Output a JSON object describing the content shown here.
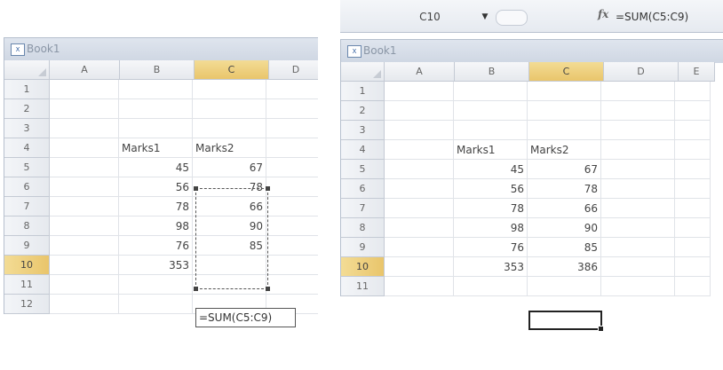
{
  "left": {
    "window_title": "Book1",
    "columns": [
      "A",
      "B",
      "C",
      "D"
    ],
    "selected_column": "C",
    "rows": [
      {
        "num": "1",
        "b": "",
        "c": ""
      },
      {
        "num": "2",
        "b": "",
        "c": ""
      },
      {
        "num": "3",
        "b": "",
        "c": ""
      },
      {
        "num": "4",
        "b": "Marks1",
        "c": "Marks2"
      },
      {
        "num": "5",
        "b": "45",
        "c": "67"
      },
      {
        "num": "6",
        "b": "56",
        "c": "78"
      },
      {
        "num": "7",
        "b": "78",
        "c": "66"
      },
      {
        "num": "8",
        "b": "98",
        "c": "90"
      },
      {
        "num": "9",
        "b": "76",
        "c": "85"
      },
      {
        "num": "10",
        "b": "353",
        "c": ""
      },
      {
        "num": "11",
        "b": "",
        "c": ""
      },
      {
        "num": "12",
        "b": "",
        "c": ""
      }
    ],
    "editing_formula": "=SUM(C5:C9)"
  },
  "right": {
    "name_box": "C10",
    "fx_label": "fx",
    "formula": "=SUM(C5:C9)",
    "window_title": "Book1",
    "columns": [
      "A",
      "B",
      "C",
      "D",
      "E"
    ],
    "selected_column": "C",
    "rows": [
      {
        "num": "1",
        "b": "",
        "c": ""
      },
      {
        "num": "2",
        "b": "",
        "c": ""
      },
      {
        "num": "3",
        "b": "",
        "c": ""
      },
      {
        "num": "4",
        "b": "Marks1",
        "c": "Marks2"
      },
      {
        "num": "5",
        "b": "45",
        "c": "67"
      },
      {
        "num": "6",
        "b": "56",
        "c": "78"
      },
      {
        "num": "7",
        "b": "78",
        "c": "66"
      },
      {
        "num": "8",
        "b": "98",
        "c": "90"
      },
      {
        "num": "9",
        "b": "76",
        "c": "85"
      },
      {
        "num": "10",
        "b": "353",
        "c": "386"
      },
      {
        "num": "11",
        "b": "",
        "c": ""
      }
    ]
  },
  "colors": {
    "accent_selected_header": "#e9c56b",
    "grid_border": "#c4cad4"
  }
}
